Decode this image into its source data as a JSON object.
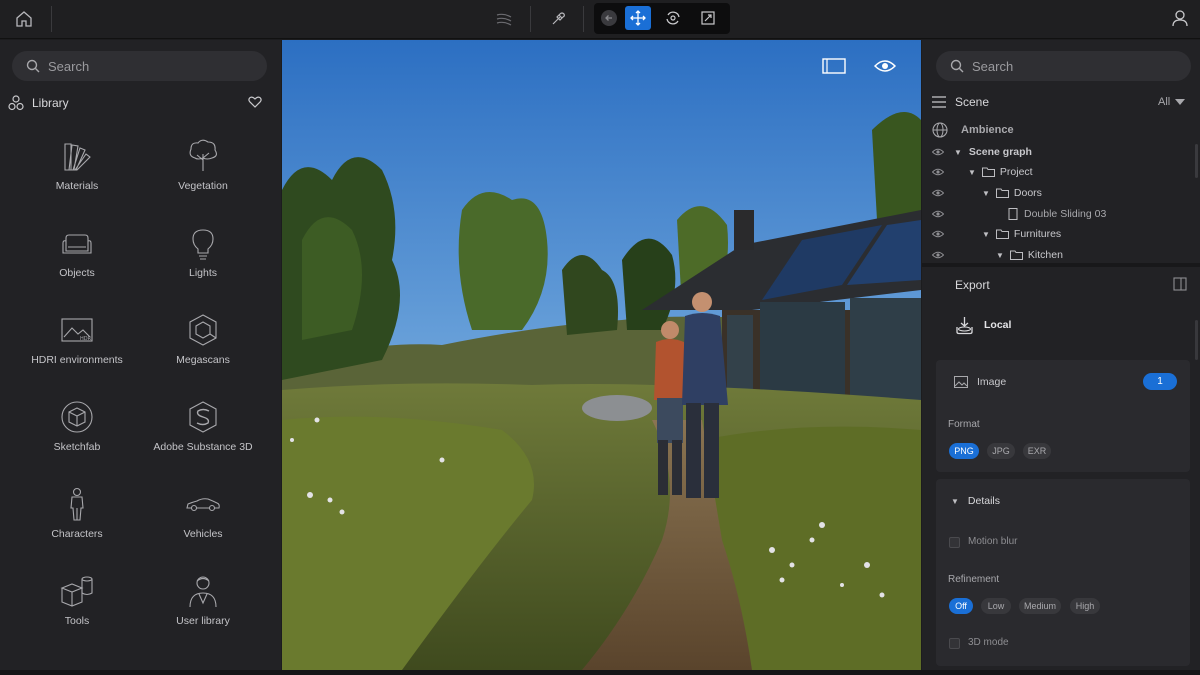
{
  "left_panel": {
    "search_placeholder": "Search",
    "library_title": "Library",
    "items": [
      {
        "label": "Materials",
        "icon": "materials-icon"
      },
      {
        "label": "Vegetation",
        "icon": "tree-icon"
      },
      {
        "label": "Objects",
        "icon": "sofa-icon"
      },
      {
        "label": "Lights",
        "icon": "lightbulb-icon"
      },
      {
        "label": "HDRI environments",
        "icon": "hdri-icon"
      },
      {
        "label": "Megascans",
        "icon": "megascans-icon"
      },
      {
        "label": "Sketchfab",
        "icon": "sketchfab-icon"
      },
      {
        "label": "Adobe Substance 3D",
        "icon": "substance-icon"
      },
      {
        "label": "Characters",
        "icon": "character-icon"
      },
      {
        "label": "Vehicles",
        "icon": "car-icon"
      },
      {
        "label": "Tools",
        "icon": "tools-icon"
      },
      {
        "label": "User library",
        "icon": "user-library-icon"
      }
    ]
  },
  "right_panel": {
    "search_placeholder": "Search",
    "scene_title": "Scene",
    "filter": "All",
    "ambience": "Ambience",
    "tree": [
      {
        "label": "Scene graph"
      },
      {
        "label": "Project"
      },
      {
        "label": "Doors"
      },
      {
        "label": "Double Sliding 03"
      },
      {
        "label": "Furnitures"
      },
      {
        "label": "Kitchen"
      }
    ],
    "export": {
      "title": "Export",
      "local": "Local",
      "image_label": "Image",
      "image_count": "1",
      "format_label": "Format",
      "formats": [
        "PNG",
        "JPG",
        "EXR"
      ],
      "details_label": "Details",
      "motion_blur": "Motion blur",
      "refinement_label": "Refinement",
      "refinement_options": [
        "Off",
        "Low",
        "Medium",
        "High"
      ],
      "mode_3d": "3D mode"
    }
  },
  "colors": {
    "accent": "#1a6fd6",
    "panel": "#222225",
    "background": "#1c1c1e"
  }
}
